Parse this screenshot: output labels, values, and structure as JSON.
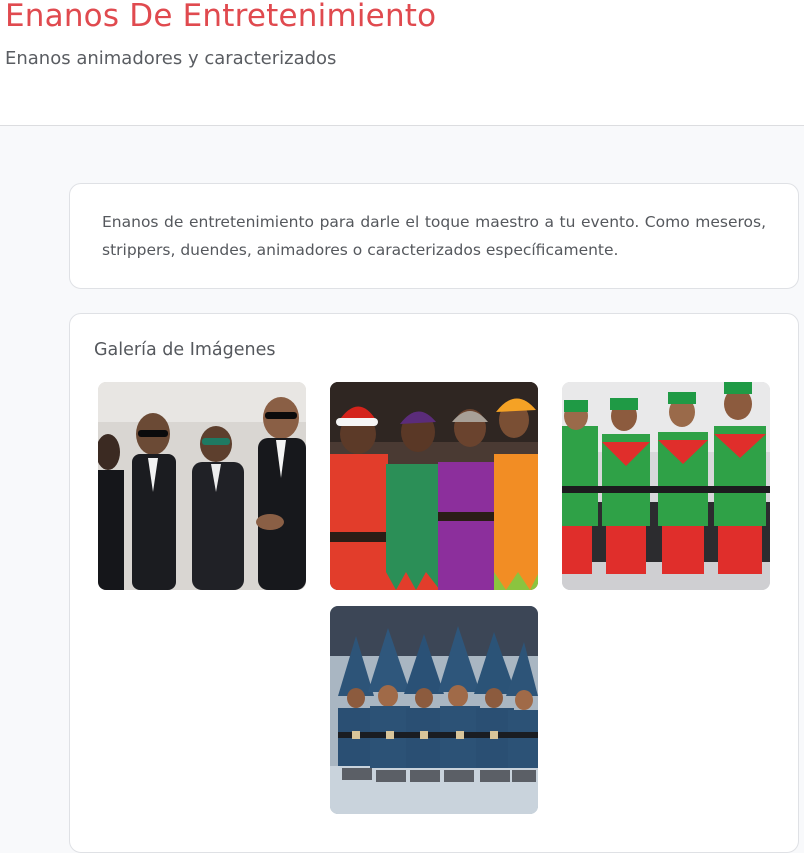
{
  "header": {
    "title": "Enanos De Entretenimiento",
    "subtitle": "Enanos animadores y caracterizados"
  },
  "intro": {
    "text": "Enanos de entretenimiento para darle el toque maestro a tu evento. Como meseros, strippers, duendes, animadores o caracterizados específicamente."
  },
  "gallery": {
    "title": "Galería de Imágenes",
    "images": [
      {
        "subject": "performers in black suits and sunglasses"
      },
      {
        "subject": "performers in colorful elf costumes"
      },
      {
        "subject": "performers in green and red elf outfits"
      },
      {
        "subject": "performers in blue gnome costumes with pointed hats"
      }
    ]
  },
  "colors": {
    "title_accent": "#e04a4f",
    "body_text": "#55585d",
    "page_background": "#f8f9fb",
    "card_border": "#dfe1e5"
  }
}
